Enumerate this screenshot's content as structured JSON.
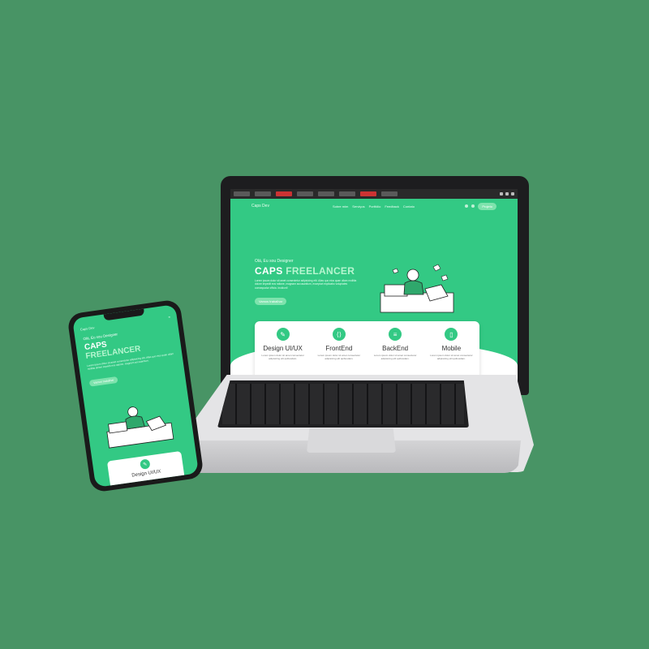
{
  "laptop": {
    "nav": {
      "logo": "Caps Dev",
      "links": [
        "Sobre mim",
        "Serviços",
        "Portfólio",
        "Feedback",
        "Contato"
      ],
      "cta": "Projeto"
    },
    "hero": {
      "eyebrow": "Olá, Eu sou Designer",
      "title_main": "CAPS",
      "title_accent": "FREELANCER",
      "description": "Lorem ipsum dolor sit amet consectetur adipisicing elit. Alias quo eius quae ullam mollitia dolore impedit eos ratione, magnam accusantium, excepturi explicabo voluptates consequatur officia. Incidunt!",
      "cta": "Vamos trabalhar"
    },
    "services": [
      {
        "icon": "pen-icon",
        "name": "Design UI/UX",
        "description": "Lorem ipsum dolor sit amet consectetur adipisicing elit quibusdam."
      },
      {
        "icon": "code-icon",
        "name": "FrontEnd",
        "description": "Lorem ipsum dolor sit amet consectetur adipisicing elit quibusdam."
      },
      {
        "icon": "server-icon",
        "name": "BackEnd",
        "description": "Lorem ipsum dolor sit amet consectetur adipisicing elit quibusdam."
      },
      {
        "icon": "mobile-icon",
        "name": "Mobile",
        "description": "Lorem ipsum dolor sit amet consectetur adipisicing elit quibusdam."
      }
    ]
  },
  "phone": {
    "logo": "Caps Dev",
    "eyebrow": "Olá, Eu sou Designer",
    "title_main": "CAPS",
    "title_accent": "FREELANCER",
    "description": "Lorem ipsum dolor sit amet consectetur adipisicing elit. Alias quo eius quae ullam mollitia dolore impedit eos ratione, magnam accusantium.",
    "cta": "Vamos trabalhar",
    "service_name": "Design UI/UX"
  },
  "colors": {
    "background": "#489465",
    "brand_green": "#33c984",
    "accent_light": "#b6f5cf"
  }
}
